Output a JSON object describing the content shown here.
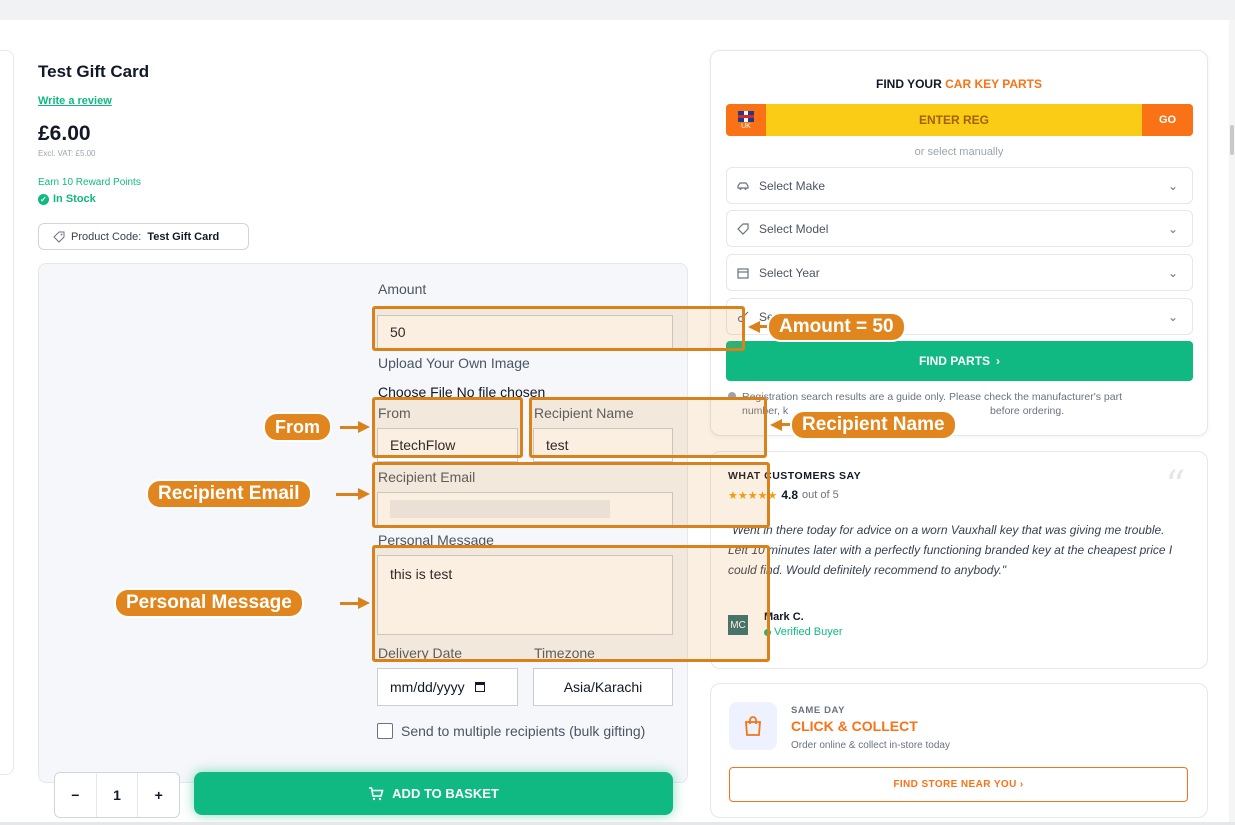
{
  "product": {
    "title": "Test Gift Card",
    "write_review": "Write a review",
    "price": "£6.00",
    "excl_vat": "Excl. VAT: £5.00",
    "reward": "Earn 10 Reward Points",
    "stock": "In Stock",
    "code_label": "Product Code:",
    "code_value": "Test Gift Card"
  },
  "form": {
    "amount_label": "Amount",
    "amount_value": "50",
    "upload_label": "Upload Your Own Image",
    "choose_file": "Choose File",
    "no_file": "No file chosen",
    "from_label": "From",
    "from_value": "EtechFlow",
    "recipient_name_label": "Recipient Name",
    "recipient_name_value": "test",
    "recipient_email_label": "Recipient Email",
    "message_label": "Personal Message",
    "message_value": "this is test",
    "delivery_label": "Delivery Date",
    "delivery_value": "mm/dd/yyyy",
    "timezone_label": "Timezone",
    "timezone_value": "Asia/Karachi",
    "bulk_label": "Send to multiple recipients (bulk gifting)",
    "qty_minus": "−",
    "qty_value": "1",
    "qty_plus": "+",
    "add_basket": "ADD TO BASKET"
  },
  "annotations": {
    "amount": "Amount = 50",
    "from": "From",
    "recipient_name": "Recipient Name",
    "recipient_email": "Recipient Email",
    "personal_message": "Personal Message"
  },
  "finder": {
    "title_prefix": "FIND YOUR ",
    "title_accent": "CAR KEY PARTS",
    "uk": "UK",
    "enter_reg": "ENTER REG",
    "go": "GO",
    "manual": "or select manually",
    "make": "Select Make",
    "model": "Select Model",
    "year": "Select Year",
    "fourth": "Se",
    "find_parts": "FIND PARTS",
    "note_a": "Registration search results are a guide only. Please check the manufacturer's part",
    "note_b1": "number, k",
    "note_b2": "before ordering."
  },
  "reviews": {
    "heading_a": "WHAT",
    "heading_b": "CUSTOMERS SAY",
    "stars": "★★★★★",
    "rating": "4.8",
    "out_of": "out of 5",
    "quote": "\"Went in there today for advice on a worn Vauxhall key that was giving me trouble. Left 10 minutes later with a perfectly functioning branded key at the cheapest price I could find. Would definitely recommend to anybody.\"",
    "avatar": "MC",
    "name": "Mark C.",
    "verified": "Verified Buyer",
    "quote_mark": "“"
  },
  "collect": {
    "same_day": "SAME DAY",
    "title": "CLICK & COLLECT",
    "sub": "Order online & collect in-store today",
    "store_button": "FIND STORE NEAR YOU"
  },
  "colors": {
    "accent_green": "#10b981",
    "accent_orange": "#f97316",
    "annotation_orange": "#e1861e"
  }
}
